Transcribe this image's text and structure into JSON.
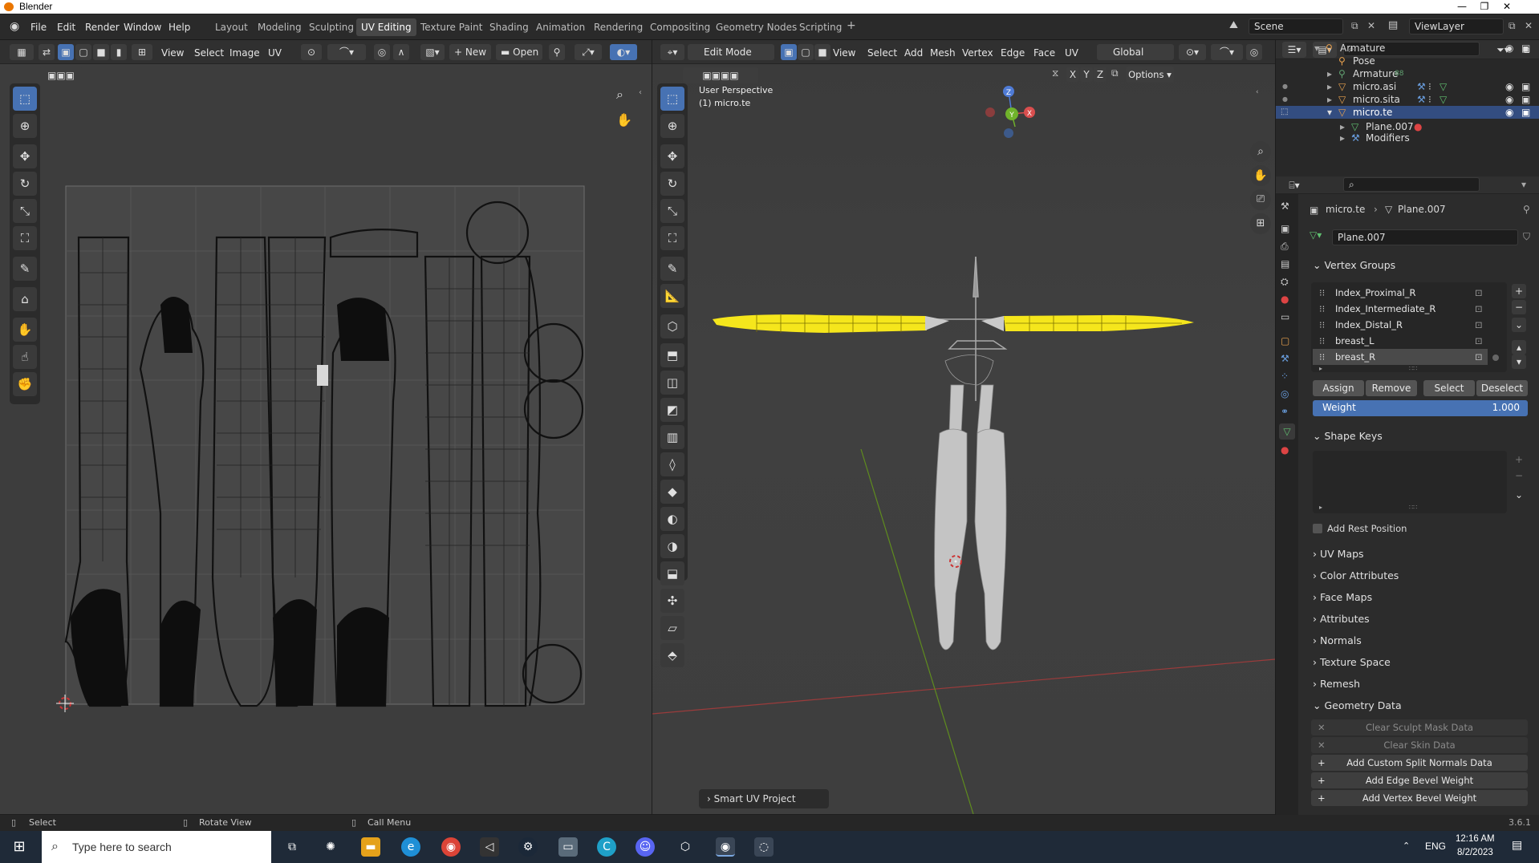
{
  "window": {
    "title": "Blender",
    "minimize": "—",
    "restore": "❐",
    "close": "✕"
  },
  "menubar": {
    "items": [
      "File",
      "Edit",
      "Render",
      "Window",
      "Help"
    ]
  },
  "workspaces": {
    "tabs": [
      "Layout",
      "Modeling",
      "Sculpting",
      "UV Editing",
      "Texture Paint",
      "Shading",
      "Animation",
      "Rendering",
      "Compositing",
      "Geometry Nodes",
      "Scripting"
    ],
    "active": "UV Editing",
    "add": "+"
  },
  "scene": {
    "label": "Scene",
    "viewlayer": "ViewLayer"
  },
  "uv_editor": {
    "menus": [
      "View",
      "Select",
      "Image",
      "UV"
    ],
    "new_label": "New",
    "open_label": "Open"
  },
  "viewport": {
    "mode": "Edit Mode",
    "menus": [
      "View",
      "Select",
      "Add",
      "Mesh",
      "Vertex",
      "Edge",
      "Face",
      "UV"
    ],
    "orientation": "Global",
    "axes": [
      "X",
      "Y",
      "Z"
    ],
    "options_label": "Options",
    "perspective_label": "User Perspective",
    "object_label": "(1) micro.te",
    "last_op": "Smart UV Project",
    "gizmo": {
      "x": "X",
      "y": "Y",
      "z": "Z"
    }
  },
  "outliner": {
    "rows": [
      {
        "label": "Armature",
        "indent": 1,
        "icon": "armature-icon"
      },
      {
        "label": "Pose",
        "indent": 2,
        "icon": "pose-icon"
      },
      {
        "label": "Armature",
        "indent": 2,
        "icon": "armature-data-icon",
        "badge": "88"
      },
      {
        "label": "micro.asi",
        "indent": 2,
        "icon": "mesh-object-icon"
      },
      {
        "label": "micro.sita",
        "indent": 2,
        "icon": "mesh-object-icon"
      },
      {
        "label": "micro.te",
        "indent": 2,
        "icon": "mesh-object-icon",
        "selected": true
      },
      {
        "label": "Plane.007",
        "indent": 3,
        "icon": "mesh-data-icon"
      },
      {
        "label": "Modifiers",
        "indent": 3,
        "icon": "wrench-icon"
      }
    ]
  },
  "properties": {
    "breadcrumb": [
      "micro.te",
      "Plane.007"
    ],
    "datablock": "Plane.007",
    "vertex_groups": {
      "title": "Vertex Groups",
      "items": [
        "Index_Proximal_R",
        "Index_Intermediate_R",
        "Index_Distal_R",
        "breast_L",
        "breast_R"
      ],
      "selected": "breast_R",
      "buttons": [
        "Assign",
        "Remove",
        "Select",
        "Deselect"
      ],
      "weight_label": "Weight",
      "weight_value": "1.000"
    },
    "shape_keys": {
      "title": "Shape Keys"
    },
    "add_rest_position": "Add Rest Position",
    "collapsed_panels": [
      "UV Maps",
      "Color Attributes",
      "Face Maps",
      "Attributes",
      "Normals",
      "Texture Space",
      "Remesh"
    ],
    "geometry_data": {
      "title": "Geometry Data",
      "buttons": [
        {
          "label": "Clear Sculpt Mask Data",
          "enabled": false
        },
        {
          "label": "Clear Skin Data",
          "enabled": false
        },
        {
          "label": "Add Custom Split Normals Data",
          "enabled": true
        },
        {
          "label": "Add Edge Bevel Weight",
          "enabled": true
        },
        {
          "label": "Add Vertex Bevel Weight",
          "enabled": true
        }
      ]
    }
  },
  "statusbar": {
    "select": "Select",
    "rotate": "Rotate View",
    "menu": "Call Menu",
    "version": "3.6.1"
  },
  "taskbar": {
    "search_placeholder": "Type here to search",
    "lang": "ENG",
    "time": "12:16 AM",
    "date": "8/2/2023"
  },
  "colors": {
    "accent": "#4772b3",
    "selected_row": "#334d80",
    "mesh_selected": "#f5e61c",
    "blender_orange": "#ea7600"
  }
}
